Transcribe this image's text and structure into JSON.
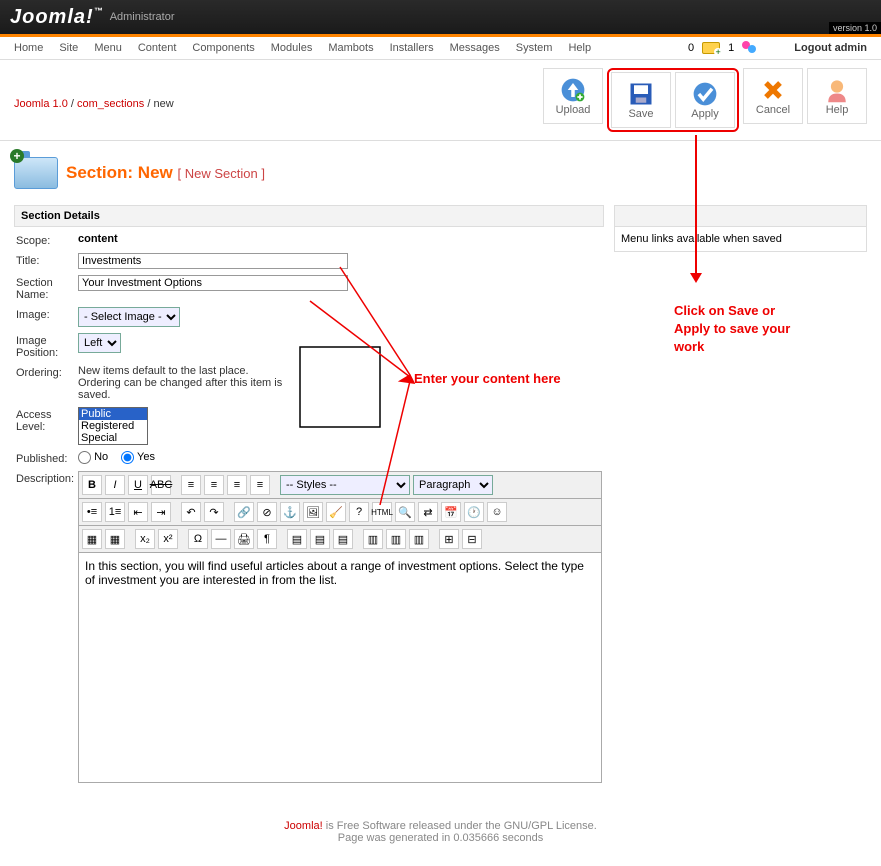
{
  "header": {
    "logo": "Joomla!",
    "logo_sub": "Administrator",
    "version": "version 1.0"
  },
  "menu": {
    "items": [
      "Home",
      "Site",
      "Menu",
      "Content",
      "Components",
      "Modules",
      "Mambots",
      "Installers",
      "Messages",
      "System",
      "Help"
    ],
    "mail_count": "0",
    "user_count": "1",
    "logout": "Logout admin"
  },
  "breadcrumb": {
    "a": "Joomla 1.0",
    "b": "com_sections",
    "c": "new"
  },
  "toolbar": {
    "upload": "Upload",
    "save": "Save",
    "apply": "Apply",
    "cancel": "Cancel",
    "help": "Help"
  },
  "page_title": {
    "section": "Section:",
    "mode": "New",
    "sub": "[ New Section ]"
  },
  "details": {
    "panel_title": "Section Details",
    "scope_label": "Scope:",
    "scope_value": "content",
    "title_label": "Title:",
    "title_value": "Investments",
    "name_label": "Section Name:",
    "name_value": "Your Investment Options",
    "image_label": "Image:",
    "image_select": "- Select Image -",
    "imgpos_label": "Image Position:",
    "imgpos_select": "Left",
    "ordering_label": "Ordering:",
    "ordering_note": "New items default to the last place. Ordering can be changed after this item is saved.",
    "access_label": "Access Level:",
    "access_options": [
      "Public",
      "Registered",
      "Special"
    ],
    "published_label": "Published:",
    "pub_no": "No",
    "pub_yes": "Yes",
    "desc_label": "Description:",
    "editor_styles": "-- Styles --",
    "editor_para": "Paragraph",
    "editor_content": "In this section, you will find useful articles about a range of investment options. Select the type of investment you are interested in from the list."
  },
  "side": {
    "menu_links": "Menu links available when saved"
  },
  "annotations": {
    "enter_content": "Enter your content here",
    "save_apply": "Click on Save or Apply to save your work"
  },
  "footer": {
    "joomla": "Joomla!",
    "text": " is Free Software released under the GNU/GPL License.",
    "gen": "Page was generated in 0.035666 seconds"
  }
}
